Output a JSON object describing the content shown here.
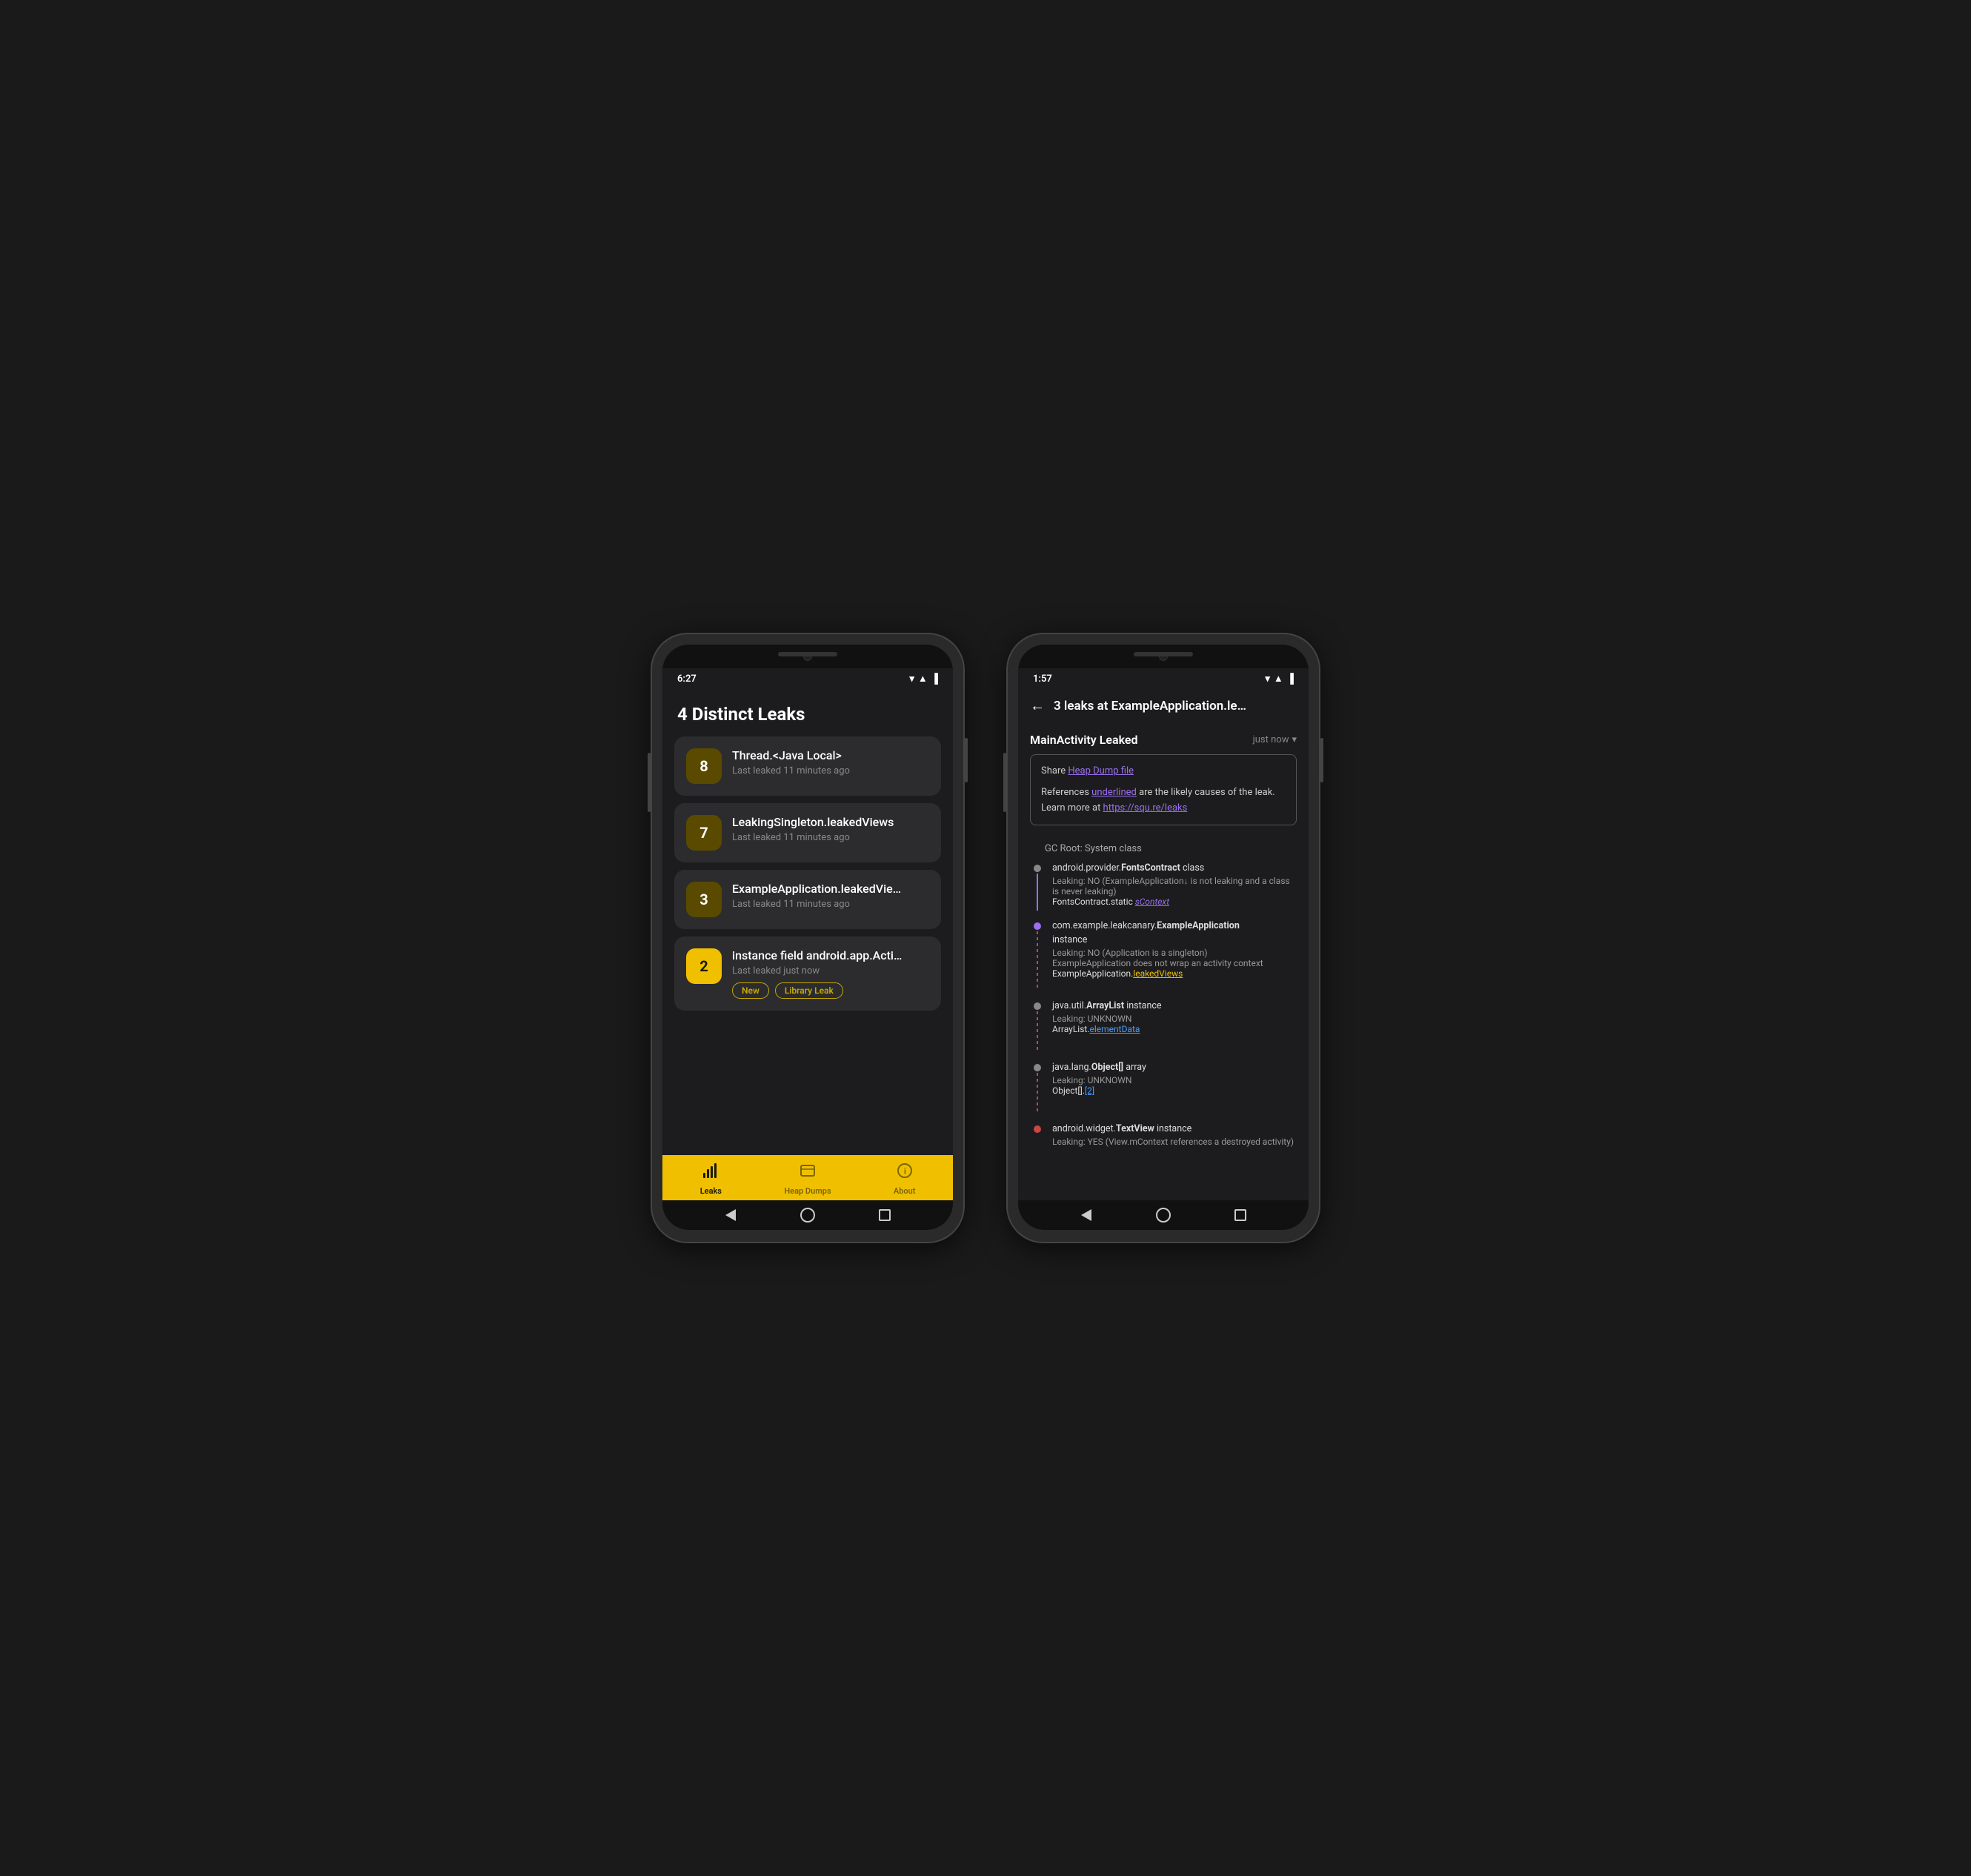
{
  "phone1": {
    "status_bar": {
      "time": "6:27",
      "wifi": "▼",
      "signal": "▲",
      "battery": "🔋"
    },
    "title": "4 Distinct Leaks",
    "leaks": [
      {
        "count": "8",
        "name": "Thread.<Java Local>",
        "time": "Last leaked 11 minutes ago",
        "badge_yellow": false,
        "tags": []
      },
      {
        "count": "7",
        "name": "LeakingSingleton.leakedViews",
        "time": "Last leaked 11 minutes ago",
        "badge_yellow": false,
        "tags": []
      },
      {
        "count": "3",
        "name": "ExampleApplication.leakedVie…",
        "time": "Last leaked 11 minutes ago",
        "badge_yellow": false,
        "tags": []
      },
      {
        "count": "2",
        "name": "instance field android.app.Acti…",
        "time": "Last leaked just now",
        "badge_yellow": true,
        "tags": [
          "New",
          "Library Leak"
        ]
      }
    ],
    "nav": [
      {
        "icon": "leaks",
        "label": "Leaks",
        "active": true
      },
      {
        "icon": "heap",
        "label": "Heap Dumps",
        "active": false
      },
      {
        "icon": "about",
        "label": "About",
        "active": false
      }
    ]
  },
  "phone2": {
    "status_bar": {
      "time": "1:57",
      "wifi": "▼",
      "signal": "▲",
      "battery": "🔋"
    },
    "header_title": "3 leaks at ExampleApplication.le…",
    "leak_class": "MainActivity Leaked",
    "leak_time": "just now",
    "info_box": {
      "share_label": "Share ",
      "share_link": "Heap Dump file",
      "description": "References ",
      "underlined": "underlined",
      "description2": " are the likely causes of the leak. Learn more at ",
      "learn_link": "https://squ.re/leaks"
    },
    "trace": [
      {
        "header": "GC Root: System class",
        "is_header": true
      },
      {
        "class": "android.provider.FontsContract",
        "type": "class",
        "leaking": "Leaking: NO (ExampleApplication↓ is not leaking and a class is never leaking)",
        "field": "FontsContract.static ",
        "field_link": "sContext",
        "field_link_style": "italic",
        "dot_color": "grey",
        "connector_color": "purple"
      },
      {
        "class": "com.example.leakcanary.ExampleApplication",
        "type": "instance",
        "leaking": "Leaking: NO (Application is a singleton)\nExampleApplication does not wrap an activity context",
        "field": "ExampleApplication.",
        "field_link": "leakedViews",
        "field_link_style": "yellow",
        "dot_color": "purple",
        "connector_color": "dashed"
      },
      {
        "class": "java.util.ArrayList",
        "type": "instance",
        "leaking": "Leaking: UNKNOWN",
        "field": "ArrayList.",
        "field_link": "elementData",
        "field_link_style": "blue",
        "dot_color": "grey",
        "connector_color": "dashed"
      },
      {
        "class": "java.lang.Object[]",
        "type": "array",
        "leaking": "Leaking: UNKNOWN",
        "field": "Object[].",
        "field_link": "[2]",
        "field_link_style": "blue",
        "dot_color": "grey",
        "connector_color": "dashed"
      },
      {
        "class": "android.widget.TextView",
        "type": "instance",
        "leaking": "Leaking: YES (View.mContext references a destroyed activity)",
        "field": "",
        "field_link": "",
        "dot_color": "red",
        "connector_color": "none"
      }
    ]
  }
}
